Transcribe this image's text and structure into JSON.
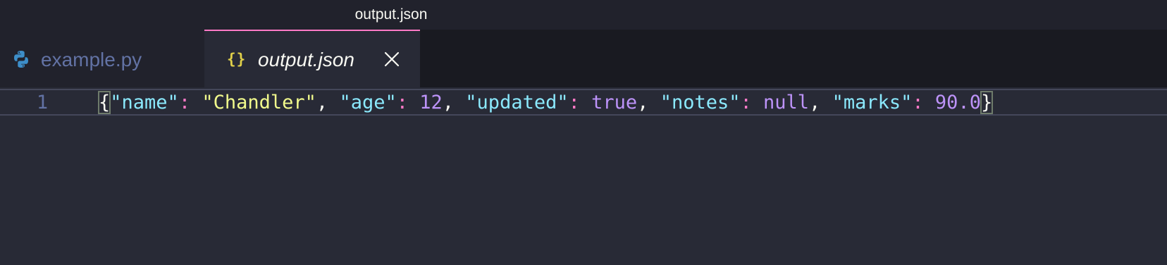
{
  "window": {
    "title": "output.json"
  },
  "tabs": [
    {
      "label": "example.py",
      "icon": "python-icon",
      "active": false
    },
    {
      "label": "output.json",
      "icon": "json-braces-icon",
      "icon_glyph": "{}",
      "active": true
    }
  ],
  "editor": {
    "line_number": "1",
    "tokens": {
      "open_brace": "{",
      "k1": "\"name\"",
      "c1": ":",
      "v1": "\"Chandler\"",
      "p1": ",",
      "k2": "\"age\"",
      "c2": ":",
      "v2": "12",
      "p2": ",",
      "k3": "\"updated\"",
      "c3": ":",
      "v3": "true",
      "p3": ",",
      "k4": "\"notes\"",
      "c4": ":",
      "v4": "null",
      "p4": ",",
      "k5": "\"marks\"",
      "c5": ":",
      "v5": "90.0",
      "close_brace": "}"
    }
  },
  "colors": {
    "background": "#282a36",
    "tab_bar": "#191a21",
    "active_tab_border": "#ff79c6",
    "key": "#8be9fd",
    "string": "#f1fa8c",
    "number": "#bd93f9",
    "colon": "#ff79c6",
    "inactive_text": "#6272a4"
  }
}
